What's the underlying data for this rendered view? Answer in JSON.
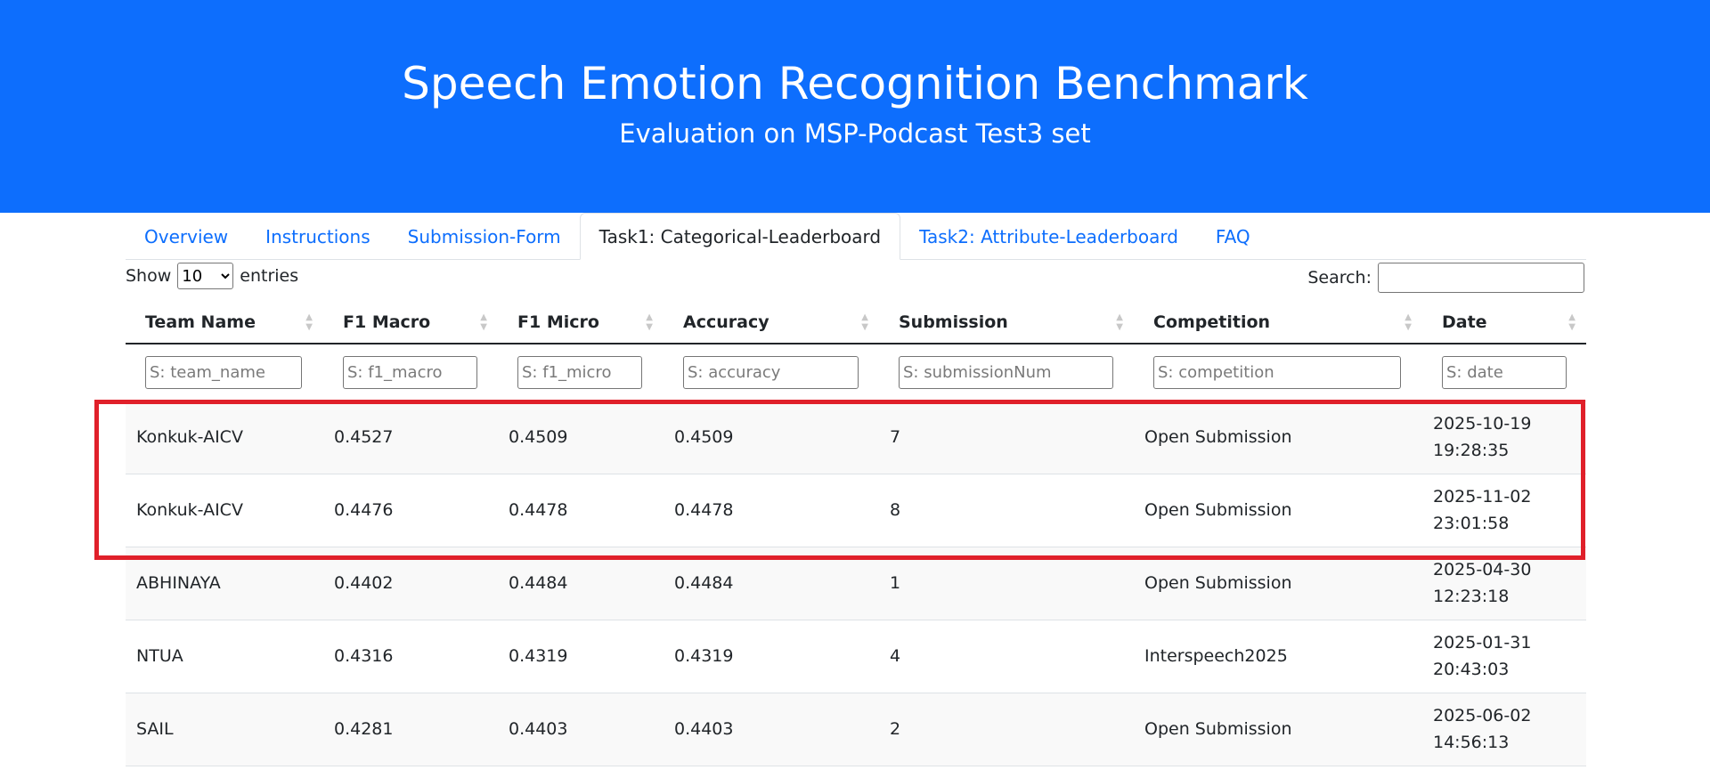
{
  "hero": {
    "title": "Speech Emotion Recognition Benchmark",
    "subtitle": "Evaluation on MSP-Podcast Test3 set",
    "background_color": "#0d6efd"
  },
  "nav": {
    "tabs": [
      {
        "label": "Overview",
        "active": false
      },
      {
        "label": "Instructions",
        "active": false
      },
      {
        "label": "Submission-Form",
        "active": false
      },
      {
        "label": "Task1: Categorical-Leaderboard",
        "active": true
      },
      {
        "label": "Task2: Attribute-Leaderboard",
        "active": false
      },
      {
        "label": "FAQ",
        "active": false
      }
    ]
  },
  "controls": {
    "show_label": "Show",
    "entries_value": "10",
    "entries_label": "entries",
    "search_label": "Search:",
    "search_value": ""
  },
  "table": {
    "columns": [
      {
        "label": "Team Name",
        "filter_placeholder": "S: team_name"
      },
      {
        "label": "F1 Macro",
        "filter_placeholder": "S: f1_macro"
      },
      {
        "label": "F1 Micro",
        "filter_placeholder": "S: f1_micro"
      },
      {
        "label": "Accuracy",
        "filter_placeholder": "S: accuracy"
      },
      {
        "label": "Submission",
        "filter_placeholder": "S: submissionNum"
      },
      {
        "label": "Competition",
        "filter_placeholder": "S: competition"
      },
      {
        "label": "Date",
        "filter_placeholder": "S: date"
      }
    ],
    "rows": [
      {
        "team": "Konkuk-AICV",
        "f1_macro": "0.4527",
        "f1_micro": "0.4509",
        "accuracy": "0.4509",
        "submission": "7",
        "competition": "Open Submission",
        "date": "2025-10-19",
        "time": "19:28:35"
      },
      {
        "team": "Konkuk-AICV",
        "f1_macro": "0.4476",
        "f1_micro": "0.4478",
        "accuracy": "0.4478",
        "submission": "8",
        "competition": "Open Submission",
        "date": "2025-11-02",
        "time": "23:01:58"
      },
      {
        "team": "ABHINAYA",
        "f1_macro": "0.4402",
        "f1_micro": "0.4484",
        "accuracy": "0.4484",
        "submission": "1",
        "competition": "Open Submission",
        "date": "2025-04-30",
        "time": "12:23:18"
      },
      {
        "team": "NTUA",
        "f1_macro": "0.4316",
        "f1_micro": "0.4319",
        "accuracy": "0.4319",
        "submission": "4",
        "competition": "Interspeech2025",
        "date": "2025-01-31",
        "time": "20:43:03"
      },
      {
        "team": "SAIL",
        "f1_macro": "0.4281",
        "f1_micro": "0.4403",
        "accuracy": "0.4403",
        "submission": "2",
        "competition": "Open Submission",
        "date": "2025-06-02",
        "time": "14:56:13"
      }
    ]
  },
  "annotation": {
    "highlight_color": "#e0202a"
  }
}
